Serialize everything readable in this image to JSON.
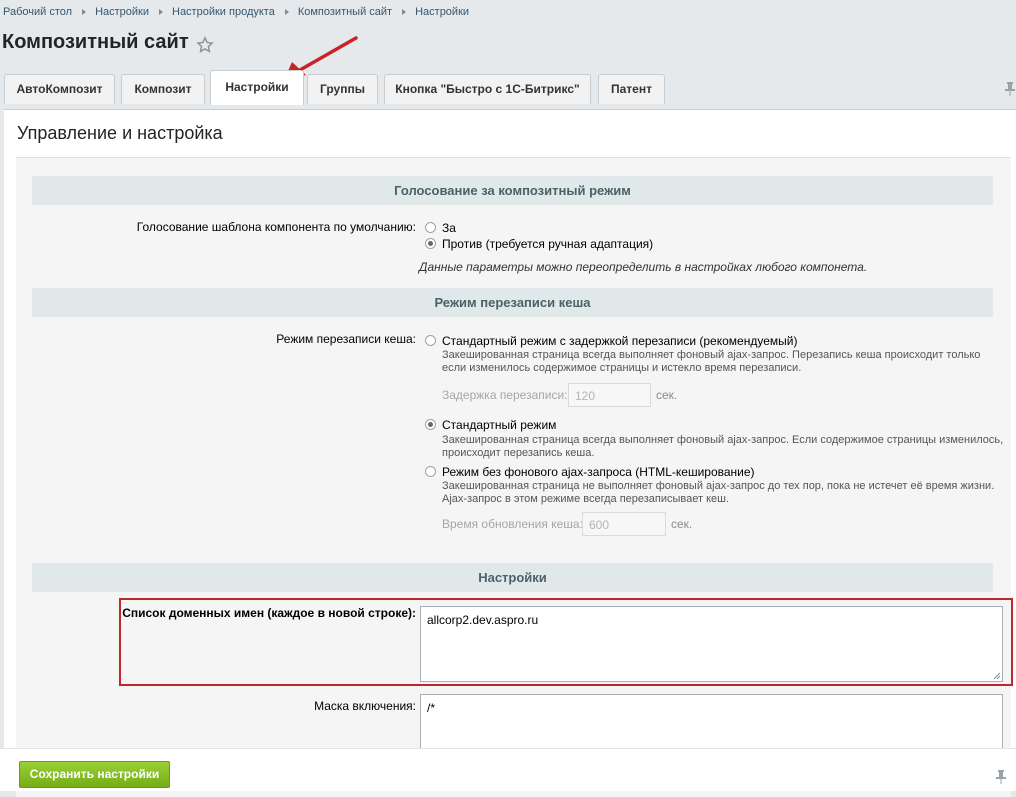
{
  "breadcrumb": [
    "Рабочий стол",
    "Настройки",
    "Настройки продукта",
    "Композитный сайт",
    "Настройки"
  ],
  "page_title": "Композитный сайт",
  "tabs": [
    {
      "label": "АвтоКомпозит"
    },
    {
      "label": "Композит"
    },
    {
      "label": "Настройки",
      "active": true
    },
    {
      "label": "Группы"
    },
    {
      "label": "Кнопка \"Быстро с 1С-Битрикс\""
    },
    {
      "label": "Патент"
    }
  ],
  "panel_title": "Управление и настройка",
  "sections": {
    "voting": {
      "title": "Голосование за композитный режим",
      "label": "Голосование шаблона компонента по умолчанию:",
      "options": [
        {
          "label": "За",
          "checked": false
        },
        {
          "label": "Против (требуется ручная адаптация)",
          "checked": true
        }
      ],
      "note": "Данные параметры можно переопределить в настройках любого компонета."
    },
    "cache": {
      "title": "Режим перезаписи кеша",
      "label": "Режим перезаписи кеша:",
      "options": [
        {
          "label": "Стандартный режим с задержкой перезаписи (рекомендуемый)",
          "checked": false,
          "hint": [
            "Закешированная страница всегда выполняет фоновый ajax-запрос. Перезапись кеша происходит только",
            "если изменилось содержимое страницы и истекло время перезаписи."
          ],
          "field": {
            "label": "Задержка перезаписи:",
            "value": "120",
            "unit": "сек."
          }
        },
        {
          "label": "Стандартный режим",
          "checked": true,
          "hint": [
            "Закешированная страница всегда выполняет фоновый ajax-запрос. Если содержимое страницы изменилось,",
            "происходит перезапись кеша."
          ]
        },
        {
          "label": "Режим без фонового ajax-запроса (HTML-кеширование)",
          "checked": false,
          "hint": [
            "Закешированная страница не выполняет фоновый ajax-запрос до тех пор, пока не истечет её время жизни.",
            "Ajax-запрос в этом режиме всегда перезаписывает кеш."
          ],
          "field": {
            "label": "Время обновления кеша:",
            "value": "600",
            "unit": "сек."
          }
        }
      ]
    },
    "settings": {
      "title": "Настройки",
      "domains_label": "Список доменных имен (каждое в новой строке):",
      "domains_value": "allcorp2.dev.aspro.ru",
      "mask_label": "Маска включения:",
      "mask_value": "/*"
    }
  },
  "footer": {
    "save_label": "Сохранить настройки"
  },
  "colors": {
    "highlight": "#c0262d",
    "save_button": "#7fb81e",
    "section_header": "#e0e8ea"
  },
  "icons": {
    "star": "star-icon",
    "pin": "pin-icon",
    "arrow": "annotation-arrow-icon"
  }
}
